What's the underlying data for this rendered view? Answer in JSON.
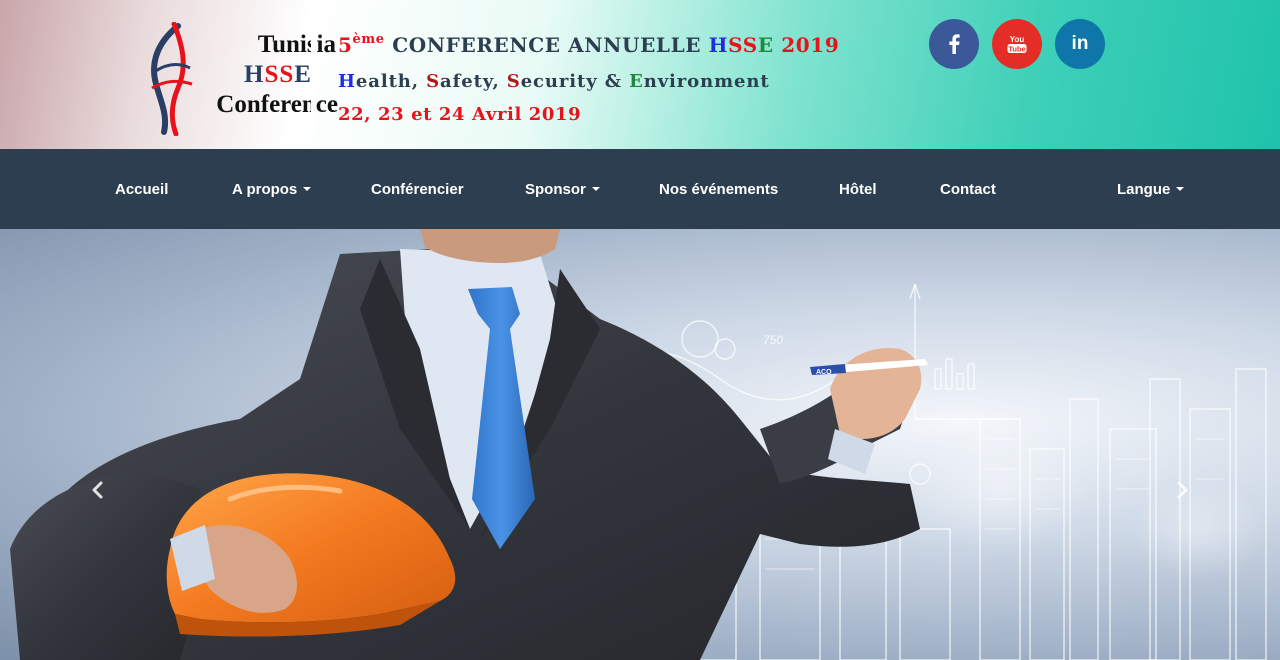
{
  "header": {
    "logo": {
      "line1": "Tunisia",
      "line2": "HSSE",
      "line3": "Conference"
    },
    "conference": {
      "ordinal": "5",
      "ordinal_suffix": "ème",
      "title_prefix": "CONFERENCE ANNUELLE",
      "title_h": "H",
      "title_ss": "SS",
      "title_e": "E",
      "title_year": "2019",
      "subtitle_h": "H",
      "subtitle_health": "ealth, ",
      "subtitle_s1": "S",
      "subtitle_safety": "afety, ",
      "subtitle_s2": "S",
      "subtitle_security": "ecurity & ",
      "subtitle_e": "E",
      "subtitle_environment": "nvironment",
      "dates": "22, 23 et 24 Avril 2019"
    },
    "social": [
      {
        "name": "facebook",
        "icon": "facebook-icon",
        "color": "#3b5998"
      },
      {
        "name": "youtube",
        "icon": "youtube-icon",
        "color": "#e52d27",
        "glyph_top": "You",
        "glyph_bottom": "Tube"
      },
      {
        "name": "linkedin",
        "icon": "linkedin-icon",
        "color": "#0e76a8",
        "glyph": "in"
      }
    ]
  },
  "navbar": {
    "background": "#2c3e50",
    "items": [
      {
        "label": "Accueil",
        "dropdown": false
      },
      {
        "label": "A propos",
        "dropdown": true
      },
      {
        "label": "Conférencier",
        "dropdown": false
      },
      {
        "label": "Sponsor",
        "dropdown": true
      },
      {
        "label": "Nos événements",
        "dropdown": false
      },
      {
        "label": "Hôtel",
        "dropdown": false
      },
      {
        "label": "Contact",
        "dropdown": false
      },
      {
        "label": "Langue",
        "dropdown": true
      }
    ]
  },
  "hero": {
    "slide_image": "businessman-with-hard-hat-and-city-sketch",
    "prev_icon": "chevron-left-icon",
    "next_icon": "chevron-right-icon",
    "marker_text": "ACO",
    "sketch_number": "750"
  },
  "colors": {
    "accent_red": "#e8121b",
    "accent_blue": "#1d2ee0",
    "accent_green": "#1f8a3a",
    "banner_teal": "#1fc2ab",
    "helmet_orange": "#f47a20"
  }
}
